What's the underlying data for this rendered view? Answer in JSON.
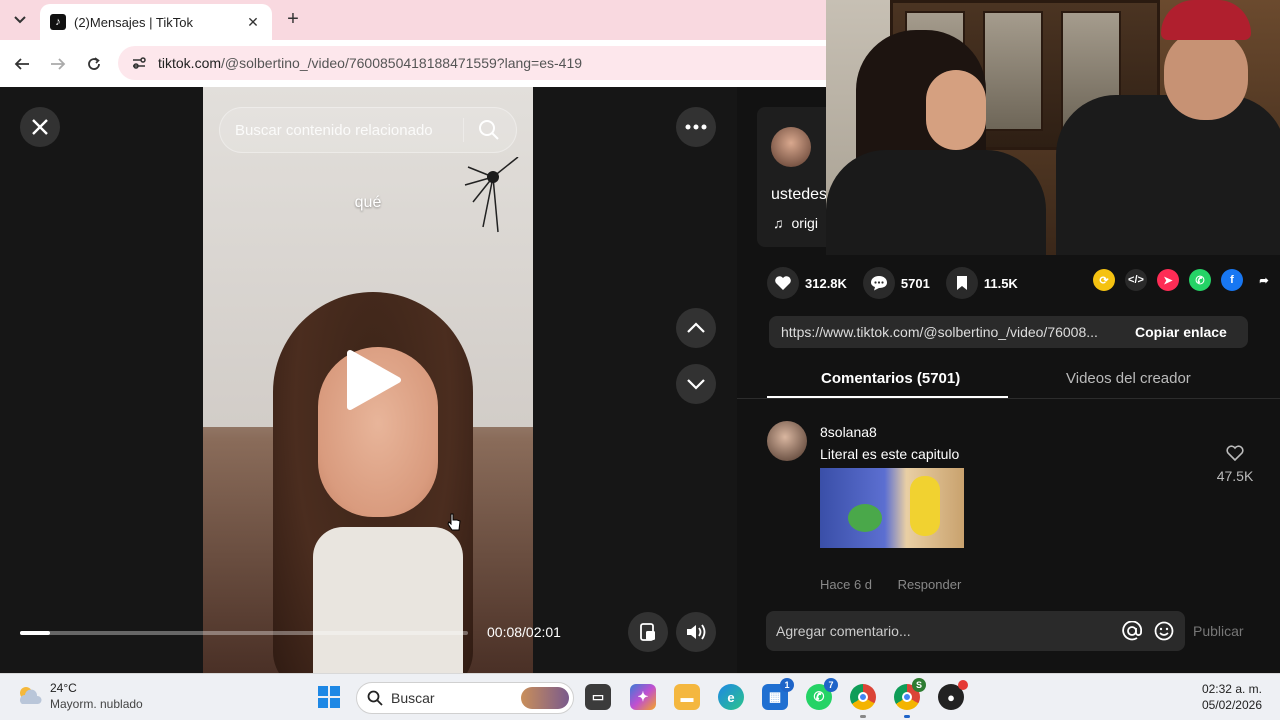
{
  "browser": {
    "tab_title": "(2)Mensajes | TikTok",
    "url_host": "tiktok.com",
    "url_path": "/@solbertino_/video/7600850418188471559?lang=es-419"
  },
  "video": {
    "search_placeholder": "Buscar contenido relacionado",
    "caption": "qué",
    "time": "00:08/02:01",
    "progress": 0.066
  },
  "panel": {
    "description": "ustedes",
    "music": "origi",
    "likes": "312.8K",
    "comments": "5701",
    "saves": "11.5K",
    "share_link": "https://www.tiktok.com/@solbertino_/video/76008...",
    "copy_link_label": "Copiar enlace",
    "tab_comments": "Comentarios (5701)",
    "tab_creator_videos": "Videos del creador",
    "comment_placeholder": "Agregar comentario...",
    "publish_label": "Publicar"
  },
  "comments": [
    {
      "user": "8solana8",
      "text": "Literal es este capitulo",
      "likes": "47.5K",
      "time": "Hace 6 d",
      "reply_label": "Responder"
    }
  ],
  "taskbar": {
    "temperature": "24°C",
    "weather": "Mayorm. nublado",
    "search_placeholder": "Buscar",
    "time": "02:32 a. m.",
    "date": "05/02/2026",
    "badges": {
      "store": "1",
      "whatsapp": "7",
      "chrome2": "S"
    }
  },
  "colors": {
    "tiktok_bg": "#121212",
    "tab_strip": "#f9d9e0",
    "whatsapp": "#25d366",
    "facebook": "#1877f2"
  }
}
